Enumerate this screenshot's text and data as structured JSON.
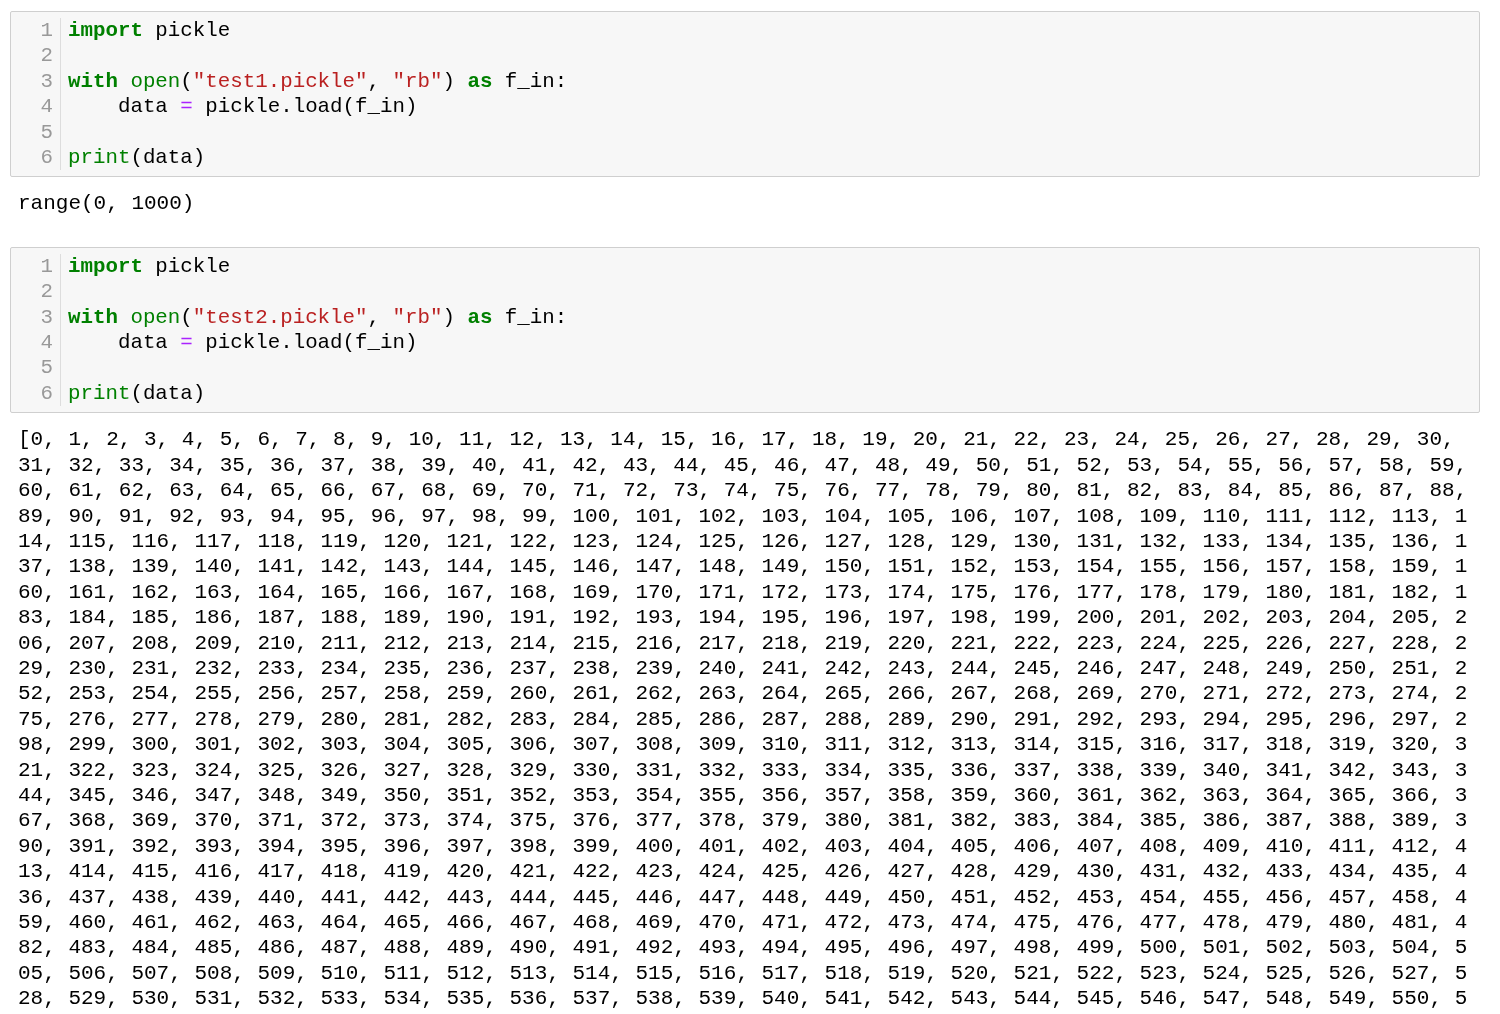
{
  "cells": [
    {
      "code_lines": [
        {
          "number": "1",
          "tokens": [
            {
              "kind": "keyword",
              "text": "import"
            },
            {
              "kind": "plain",
              "text": " pickle"
            }
          ]
        },
        {
          "number": "2"
        },
        {
          "number": "3",
          "tokens": [
            {
              "kind": "keyword",
              "text": "with "
            },
            {
              "kind": "builtin",
              "text": "open"
            },
            {
              "kind": "plain",
              "text": "("
            },
            {
              "kind": "string",
              "text": "\"test1.pickle\""
            },
            {
              "kind": "plain",
              "text": ", "
            },
            {
              "kind": "string",
              "text": "\"rb\""
            },
            {
              "kind": "plain",
              "text": ") "
            },
            {
              "kind": "keyword",
              "text": "as"
            },
            {
              "kind": "plain",
              "text": " f_in:"
            }
          ]
        },
        {
          "number": "4",
          "tokens": [
            {
              "kind": "plain",
              "text": "    data "
            },
            {
              "kind": "operator",
              "text": "="
            },
            {
              "kind": "plain",
              "text": " pickle.load(f_in)"
            }
          ]
        },
        {
          "number": "5"
        },
        {
          "number": "6",
          "tokens": [
            {
              "kind": "builtin",
              "text": "print"
            },
            {
              "kind": "plain",
              "text": "(data)"
            }
          ]
        }
      ],
      "output": [
        "range(0, 1000)"
      ]
    },
    {
      "code_lines": [
        {
          "number": "1",
          "tokens": [
            {
              "kind": "keyword",
              "text": "import"
            },
            {
              "kind": "plain",
              "text": " pickle"
            }
          ]
        },
        {
          "number": "2"
        },
        {
          "number": "3",
          "tokens": [
            {
              "kind": "keyword",
              "text": "with "
            },
            {
              "kind": "builtin",
              "text": "open"
            },
            {
              "kind": "plain",
              "text": "("
            },
            {
              "kind": "string",
              "text": "\"test2.pickle\""
            },
            {
              "kind": "plain",
              "text": ", "
            },
            {
              "kind": "string",
              "text": "\"rb\""
            },
            {
              "kind": "plain",
              "text": ") "
            },
            {
              "kind": "keyword",
              "text": "as"
            },
            {
              "kind": "plain",
              "text": " f_in:"
            }
          ]
        },
        {
          "number": "4",
          "tokens": [
            {
              "kind": "plain",
              "text": "    data "
            },
            {
              "kind": "operator",
              "text": "="
            },
            {
              "kind": "plain",
              "text": " pickle.load(f_in)"
            }
          ]
        },
        {
          "number": "5"
        },
        {
          "number": "6",
          "tokens": [
            {
              "kind": "builtin",
              "text": "print"
            },
            {
              "kind": "plain",
              "text": "(data)"
            }
          ]
        }
      ],
      "output": [
        "[0, 1, 2, 3, 4, 5, 6, 7, 8, 9, 10, 11, 12, 13, 14, 15, 16, 17, 18, 19, 20, 21, 22, 23, 24, 25, 26, 27, 28, 29, 30,",
        "31, 32, 33, 34, 35, 36, 37, 38, 39, 40, 41, 42, 43, 44, 45, 46, 47, 48, 49, 50, 51, 52, 53, 54, 55, 56, 57, 58, 59,",
        "60, 61, 62, 63, 64, 65, 66, 67, 68, 69, 70, 71, 72, 73, 74, 75, 76, 77, 78, 79, 80, 81, 82, 83, 84, 85, 86, 87, 88,",
        "89, 90, 91, 92, 93, 94, 95, 96, 97, 98, 99, 100, 101, 102, 103, 104, 105, 106, 107, 108, 109, 110, 111, 112, 113, 1",
        "14, 115, 116, 117, 118, 119, 120, 121, 122, 123, 124, 125, 126, 127, 128, 129, 130, 131, 132, 133, 134, 135, 136, 1",
        "37, 138, 139, 140, 141, 142, 143, 144, 145, 146, 147, 148, 149, 150, 151, 152, 153, 154, 155, 156, 157, 158, 159, 1",
        "60, 161, 162, 163, 164, 165, 166, 167, 168, 169, 170, 171, 172, 173, 174, 175, 176, 177, 178, 179, 180, 181, 182, 1",
        "83, 184, 185, 186, 187, 188, 189, 190, 191, 192, 193, 194, 195, 196, 197, 198, 199, 200, 201, 202, 203, 204, 205, 2",
        "06, 207, 208, 209, 210, 211, 212, 213, 214, 215, 216, 217, 218, 219, 220, 221, 222, 223, 224, 225, 226, 227, 228, 2",
        "29, 230, 231, 232, 233, 234, 235, 236, 237, 238, 239, 240, 241, 242, 243, 244, 245, 246, 247, 248, 249, 250, 251, 2",
        "52, 253, 254, 255, 256, 257, 258, 259, 260, 261, 262, 263, 264, 265, 266, 267, 268, 269, 270, 271, 272, 273, 274, 2",
        "75, 276, 277, 278, 279, 280, 281, 282, 283, 284, 285, 286, 287, 288, 289, 290, 291, 292, 293, 294, 295, 296, 297, 2",
        "98, 299, 300, 301, 302, 303, 304, 305, 306, 307, 308, 309, 310, 311, 312, 313, 314, 315, 316, 317, 318, 319, 320, 3",
        "21, 322, 323, 324, 325, 326, 327, 328, 329, 330, 331, 332, 333, 334, 335, 336, 337, 338, 339, 340, 341, 342, 343, 3",
        "44, 345, 346, 347, 348, 349, 350, 351, 352, 353, 354, 355, 356, 357, 358, 359, 360, 361, 362, 363, 364, 365, 366, 3",
        "67, 368, 369, 370, 371, 372, 373, 374, 375, 376, 377, 378, 379, 380, 381, 382, 383, 384, 385, 386, 387, 388, 389, 3",
        "90, 391, 392, 393, 394, 395, 396, 397, 398, 399, 400, 401, 402, 403, 404, 405, 406, 407, 408, 409, 410, 411, 412, 4",
        "13, 414, 415, 416, 417, 418, 419, 420, 421, 422, 423, 424, 425, 426, 427, 428, 429, 430, 431, 432, 433, 434, 435, 4",
        "36, 437, 438, 439, 440, 441, 442, 443, 444, 445, 446, 447, 448, 449, 450, 451, 452, 453, 454, 455, 456, 457, 458, 4",
        "59, 460, 461, 462, 463, 464, 465, 466, 467, 468, 469, 470, 471, 472, 473, 474, 475, 476, 477, 478, 479, 480, 481, 4",
        "82, 483, 484, 485, 486, 487, 488, 489, 490, 491, 492, 493, 494, 495, 496, 497, 498, 499, 500, 501, 502, 503, 504, 5",
        "05, 506, 507, 508, 509, 510, 511, 512, 513, 514, 515, 516, 517, 518, 519, 520, 521, 522, 523, 524, 525, 526, 527, 5",
        "28, 529, 530, 531, 532, 533, 534, 535, 536, 537, 538, 539, 540, 541, 542, 543, 544, 545, 546, 547, 548, 549, 550, 5"
      ]
    }
  ]
}
